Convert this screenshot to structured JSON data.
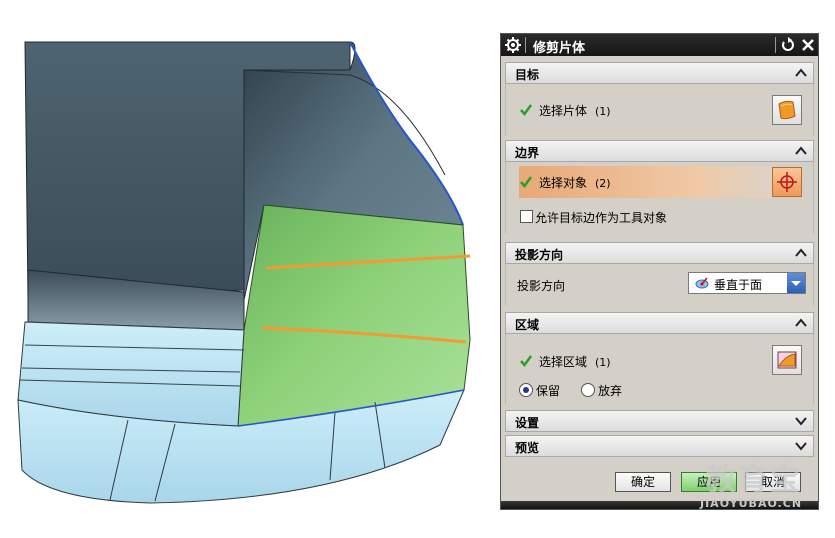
{
  "dialog": {
    "title": "修剪片体",
    "sections": {
      "target": {
        "label": "目标",
        "select_label": "选择片体",
        "count": "(1)"
      },
      "boundary": {
        "label": "边界",
        "select_label": "选择对象",
        "count": "(2)",
        "checkbox_label": "允许目标边作为工具对象",
        "checkbox_checked": false
      },
      "projection": {
        "label": "投影方向",
        "field_label": "投影方向",
        "dropdown_value": "垂直于面"
      },
      "region": {
        "label": "区域",
        "select_label": "选择区域",
        "count": "(1)",
        "keep_label": "保留",
        "discard_label": "放弃",
        "selected": "keep"
      },
      "settings": {
        "label": "设置"
      },
      "preview": {
        "label": "预览"
      }
    },
    "buttons": {
      "ok": "确定",
      "apply": "应用",
      "cancel": "取消"
    }
  },
  "watermark": {
    "text": "教育宝",
    "url": "JIAOYUBAO.CN"
  },
  "colors": {
    "accent_orange": "#e8a070",
    "check_green": "#2aa02a",
    "title_bg": "#1e1e1e",
    "surface_green": "#8fd27a",
    "surface_blue": "#bfe6f4"
  }
}
